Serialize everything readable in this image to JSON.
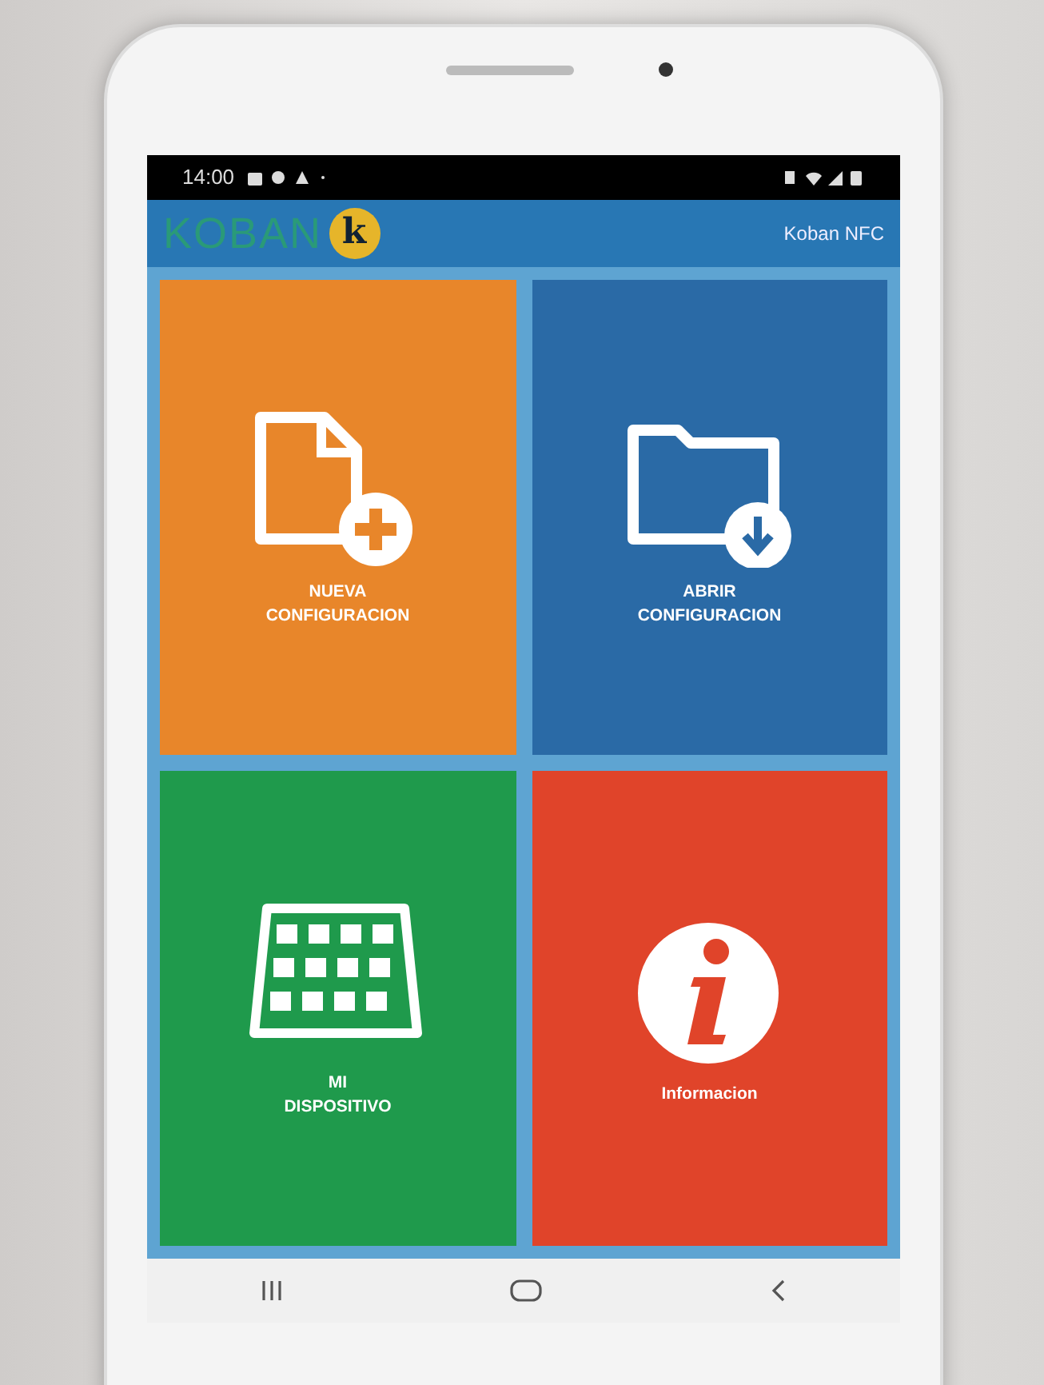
{
  "status_bar": {
    "time": "14:00"
  },
  "app_bar": {
    "logo_text": "KOBAN",
    "logo_letter": "k",
    "title": "Koban NFC"
  },
  "tiles": [
    {
      "kind": "new-file",
      "label_lines": [
        "NUEVA",
        "CONFIGURACION"
      ],
      "color": "#e8862a"
    },
    {
      "kind": "open-folder",
      "label_lines": [
        "ABRIR",
        "CONFIGURACION"
      ],
      "color": "#2a6aa6"
    },
    {
      "kind": "device",
      "label_lines": [
        "MI",
        "DISPOSITIVO"
      ],
      "color": "#1f9a4c"
    },
    {
      "kind": "info",
      "label_lines": [
        "Informacion"
      ],
      "color": "#e0442a"
    }
  ]
}
